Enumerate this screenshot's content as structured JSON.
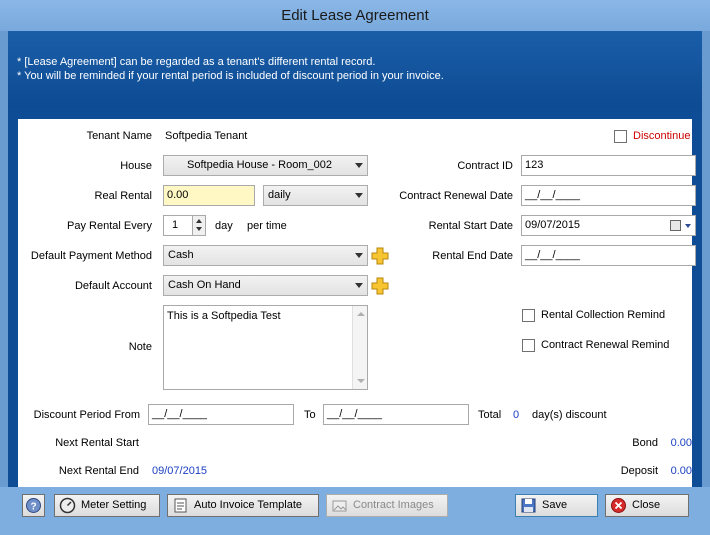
{
  "window": {
    "title": "Edit Lease Agreement"
  },
  "banner": {
    "line1": "* [Lease Agreement] can be regarded as a tenant's different rental record.",
    "line2": "* You will be reminded if your rental period is included of discount period in your invoice."
  },
  "form": {
    "tenant_name_label": "Tenant Name",
    "tenant_name_value": "Softpedia Tenant",
    "discontinue_label": "Discontinue",
    "house_label": "House",
    "house_value": "Softpedia House - Room_002",
    "contract_id_label": "Contract ID",
    "contract_id_value": "123",
    "real_rental_label": "Real Rental",
    "real_rental_value": "0.00",
    "rental_period_value": "daily",
    "contract_renewal_date_label": "Contract Renewal Date",
    "contract_renewal_date_value": "__/__/____",
    "pay_rental_every_label": "Pay Rental Every",
    "pay_rental_every_value": "1",
    "day_label": "day",
    "per_time_label": "per time",
    "rental_start_date_label": "Rental Start Date",
    "rental_start_date_value": "09/07/2015",
    "default_payment_method_label": "Default Payment Method",
    "default_payment_method_value": "Cash",
    "rental_end_date_label": "Rental End Date",
    "rental_end_date_value": "__/__/____",
    "default_account_label": "Default Account",
    "default_account_value": "Cash On Hand",
    "note_label": "Note",
    "note_value": "This is a Softpedia Test",
    "rental_collection_remind_label": "Rental Collection Remind",
    "contract_renewal_remind_label": "Contract Renewal Remind",
    "discount_period_from_label": "Discount Period From",
    "discount_from_value": "__/__/____",
    "to_label": "To",
    "discount_to_value": "__/__/____",
    "total_label": "Total",
    "total_value": "0",
    "days_discount_label": "day(s) discount",
    "next_rental_start_label": "Next Rental Start",
    "next_rental_start_value": "",
    "bond_label": "Bond",
    "bond_value": "0.00",
    "next_rental_end_label": "Next Rental End",
    "next_rental_end_value": "09/07/2015",
    "deposit_label": "Deposit",
    "deposit_value": "0.00"
  },
  "buttons": {
    "meter_setting": "Meter Setting",
    "auto_invoice_template": "Auto Invoice Template",
    "contract_images": "Contract Images",
    "save": "Save",
    "close": "Close"
  },
  "colors": {
    "title_bar": "#80b0e2",
    "banner": "#1158a3",
    "accent_blue": "#1a3fc0",
    "discontinue_red": "#cc0000",
    "real_rental_bg": "#fff8c4"
  }
}
